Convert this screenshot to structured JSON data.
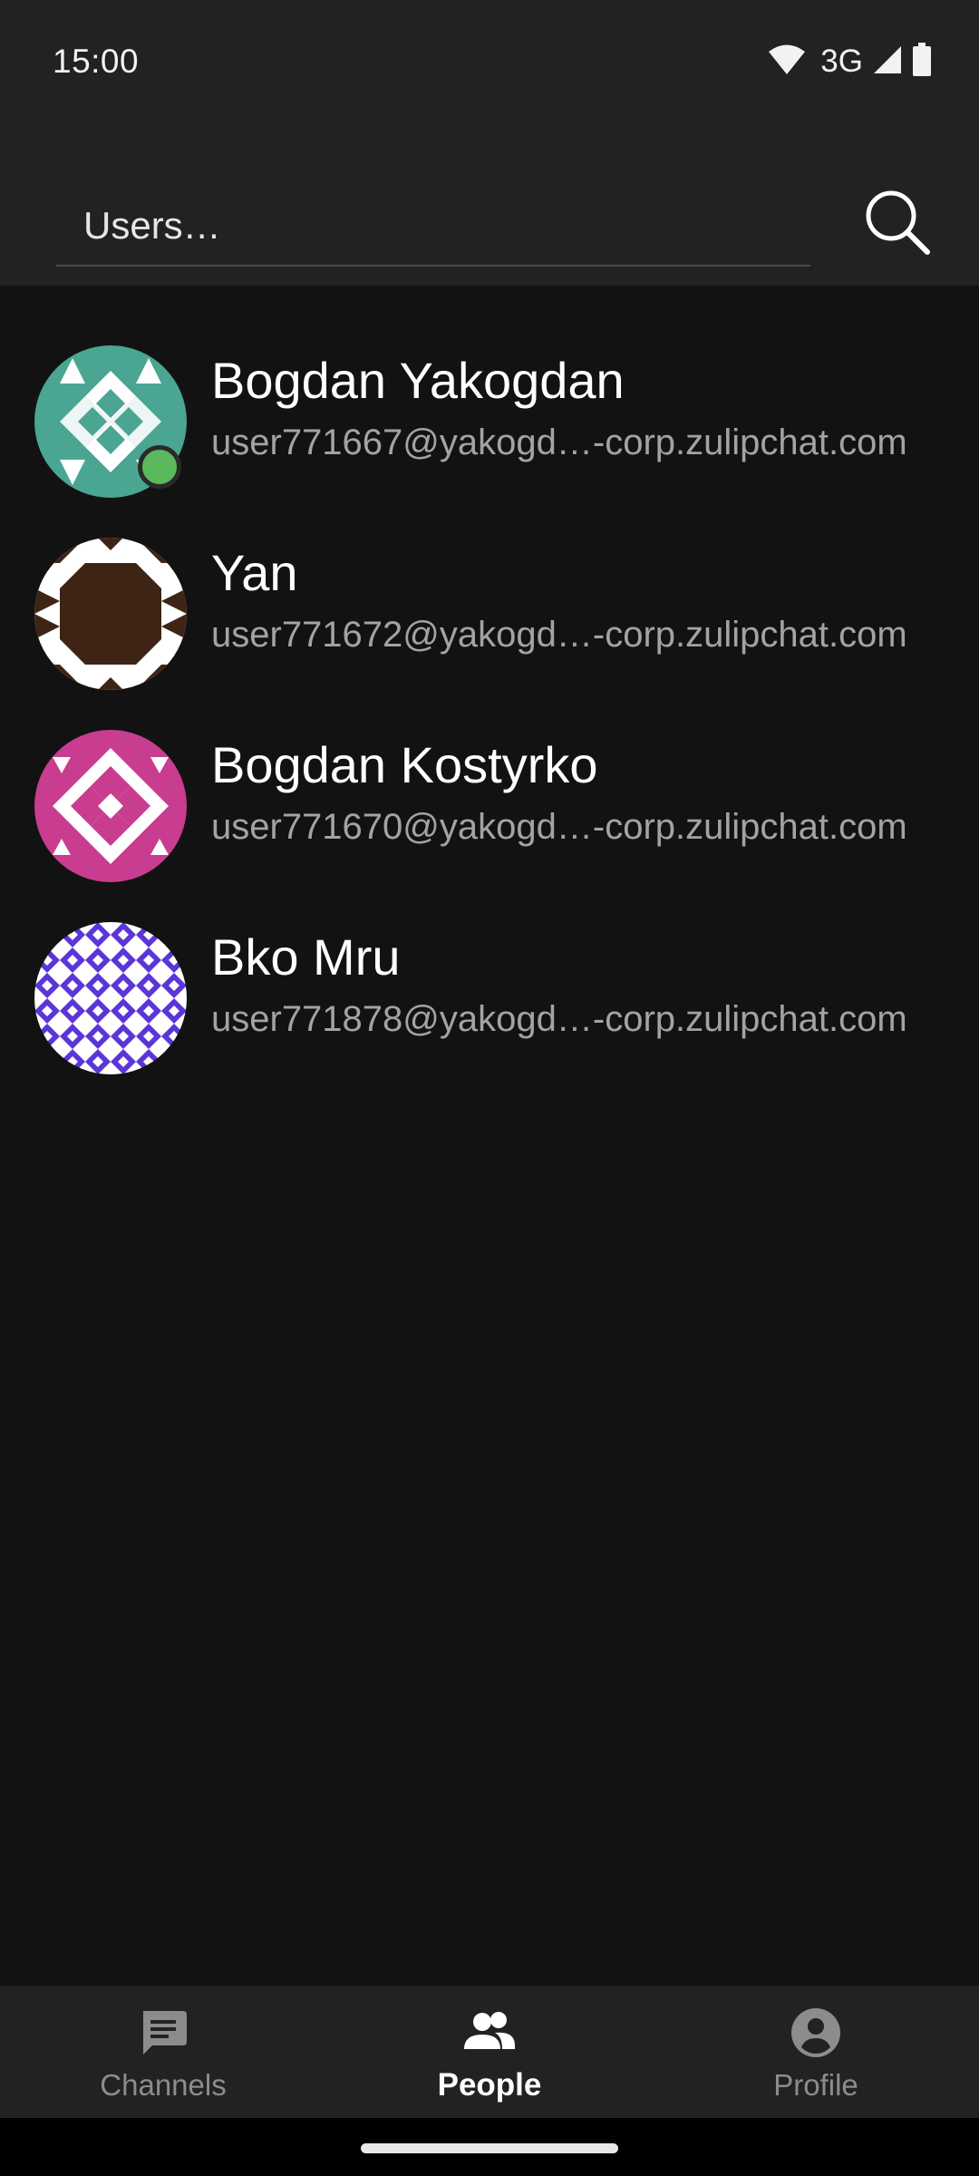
{
  "status_bar": {
    "time": "15:00",
    "network": "3G",
    "icons": [
      "wifi-icon",
      "cell-signal-icon",
      "battery-icon"
    ]
  },
  "search": {
    "placeholder": "Users…",
    "value": "",
    "button_icon": "search-icon"
  },
  "users": [
    {
      "name": "Bogdan Yakogdan",
      "email": "user771667@yakogd…-corp.zulipchat.com",
      "online": true,
      "avatar_color": "#4aa592"
    },
    {
      "name": "Yan",
      "email": "user771672@yakogd…-corp.zulipchat.com",
      "online": false,
      "avatar_color": "#3d2414"
    },
    {
      "name": "Bogdan Kostyrko",
      "email": "user771670@yakogd…-corp.zulipchat.com",
      "online": false,
      "avatar_color": "#c83d8f"
    },
    {
      "name": "Bko Mru",
      "email": "user771878@yakogd…-corp.zulipchat.com",
      "online": false,
      "avatar_color": "#5b35d8"
    }
  ],
  "bottom_nav": {
    "items": [
      {
        "label": "Channels",
        "icon": "chat-icon",
        "active": false
      },
      {
        "label": "People",
        "icon": "people-icon",
        "active": true
      },
      {
        "label": "Profile",
        "icon": "profile-icon",
        "active": false
      }
    ]
  },
  "colors": {
    "background": "#121212",
    "bar_background": "#222222",
    "presence_online": "#5cb85c",
    "text_secondary": "#a3a3a3"
  }
}
